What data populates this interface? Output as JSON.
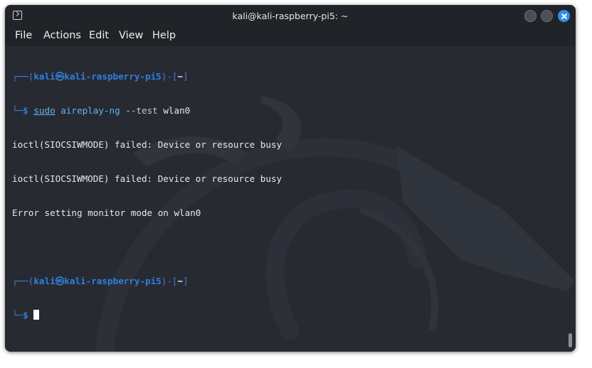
{
  "window": {
    "title": "kali@kali-raspberry-pi5: ~",
    "icons": {
      "app": "terminal-icon",
      "minimize": "minimize-icon",
      "maximize": "maximize-icon",
      "close": "close-icon"
    }
  },
  "menubar": {
    "items": [
      {
        "label": "File"
      },
      {
        "label": "Actions"
      },
      {
        "label": "Edit"
      },
      {
        "label": "View"
      },
      {
        "label": "Help"
      }
    ]
  },
  "terminal": {
    "prompt1": {
      "frame_top_left": "┌──(",
      "user": "kali",
      "skull": "㉿",
      "host": "kali-raspberry-pi5",
      "mid": ")-[",
      "dir": "~",
      "end": "]",
      "frame_bottom_left": "└─",
      "dollar": "$ ",
      "cmd_sudo": "sudo",
      "cmd_name": " aireplay-ng",
      "cmd_args": " --test",
      "cmd_target": " wlan0"
    },
    "output": [
      "ioctl(SIOCSIWMODE) failed: Device or resource busy",
      "ioctl(SIOCSIWMODE) failed: Device or resource busy",
      "Error setting monitor mode on wlan0"
    ],
    "prompt2": {
      "frame_top_left": "┌──(",
      "user": "kali",
      "skull": "㉿",
      "host": "kali-raspberry-pi5",
      "mid": ")-[",
      "dir": "~",
      "end": "]",
      "frame_bottom_left": "└─",
      "dollar": "$ "
    }
  },
  "colors": {
    "terminal_bg": "#272a31",
    "titlebar_bg": "#202328",
    "prompt_blue": "#2f7fe0",
    "command_blue": "#63b3f0",
    "close_button": "#2f8ef0"
  }
}
